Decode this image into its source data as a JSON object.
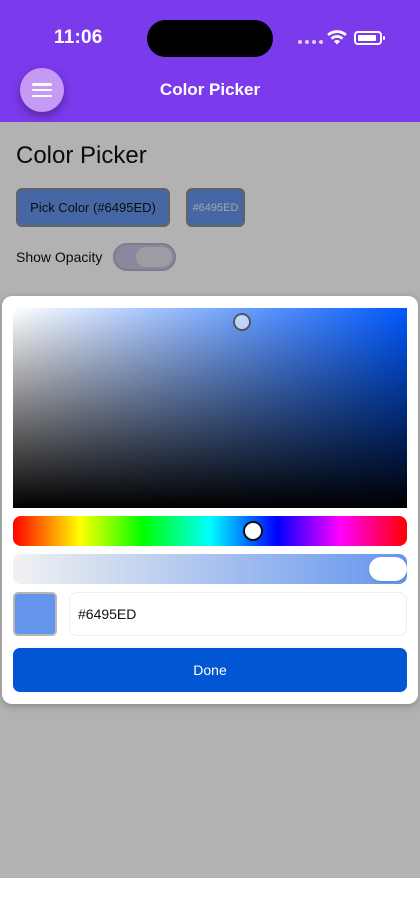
{
  "status_bar": {
    "time": "11:06"
  },
  "app_bar": {
    "title": "Color Picker",
    "menu_icon": "hamburger-menu-icon"
  },
  "page": {
    "title": "Color Picker",
    "pick_button_label": "Pick Color (#6495ED)",
    "hex_chip_label": "#6495ED",
    "selected_color": "#6495ED",
    "show_opacity_label": "Show Opacity",
    "show_opacity_on": true
  },
  "dialog": {
    "hex_value": "#6495ED",
    "done_label": "Done",
    "hue_degrees": 219,
    "saturation": 0.58,
    "brightness": 0.93,
    "alpha": 1.0,
    "accent": "#0256d4"
  }
}
